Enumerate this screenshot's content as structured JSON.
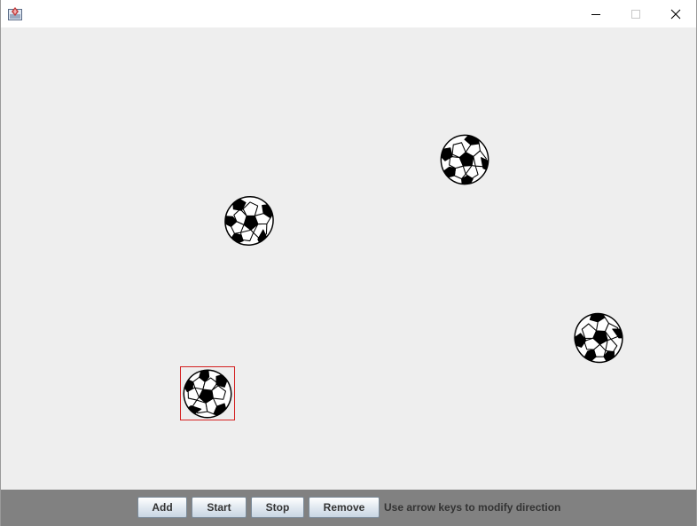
{
  "window": {
    "title": "",
    "controls": [
      "minimize-icon",
      "maximize-icon",
      "close-icon"
    ]
  },
  "canvas": {
    "background": "#eeeeee",
    "ball_count": 4,
    "ball_icon": "soccer-ball-icon",
    "selected_ball_index": 3,
    "selection_color": "#d42020"
  },
  "toolbar": {
    "add_label": "Add",
    "start_label": "Start",
    "stop_label": "Stop",
    "remove_label": "Remove",
    "hint_text": "Use arrow keys to modify direction",
    "background": "#818181"
  }
}
